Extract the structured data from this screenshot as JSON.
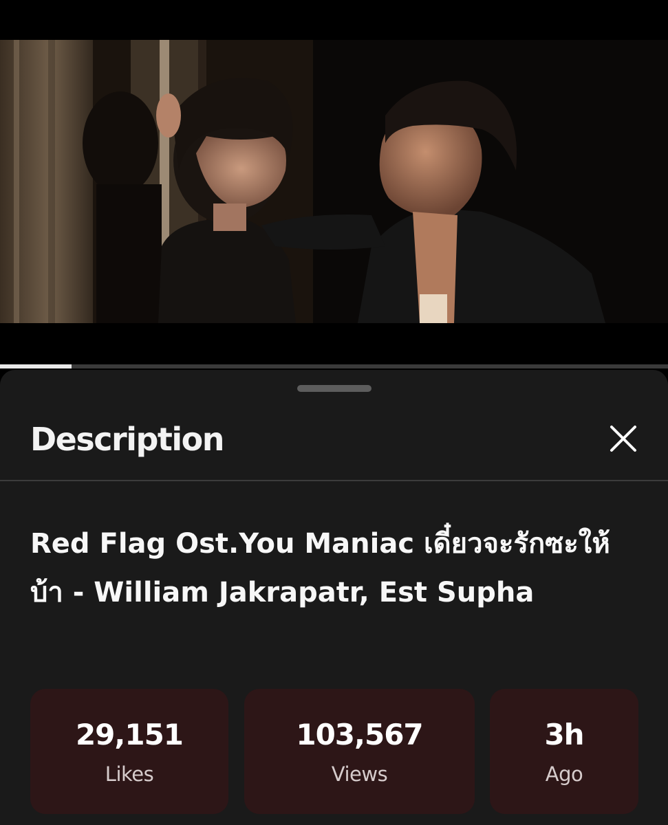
{
  "player": {
    "progress_fraction": 0.107
  },
  "description_sheet": {
    "title": "Description",
    "close_icon": "close-icon",
    "video_title": "Red Flag Ost.You Maniac เดี๋ยวจะรักซะให้บ้า - William Jakrapatr, Est Supha"
  },
  "stats": [
    {
      "value": "29,151",
      "label": "Likes"
    },
    {
      "value": "103,567",
      "label": "Views"
    },
    {
      "value": "3h",
      "label": "Ago"
    }
  ],
  "colors": {
    "sheet_background": "#1a1a1a",
    "stat_card_background": "#2d1617",
    "progress_fill": "#e9e9e9"
  }
}
